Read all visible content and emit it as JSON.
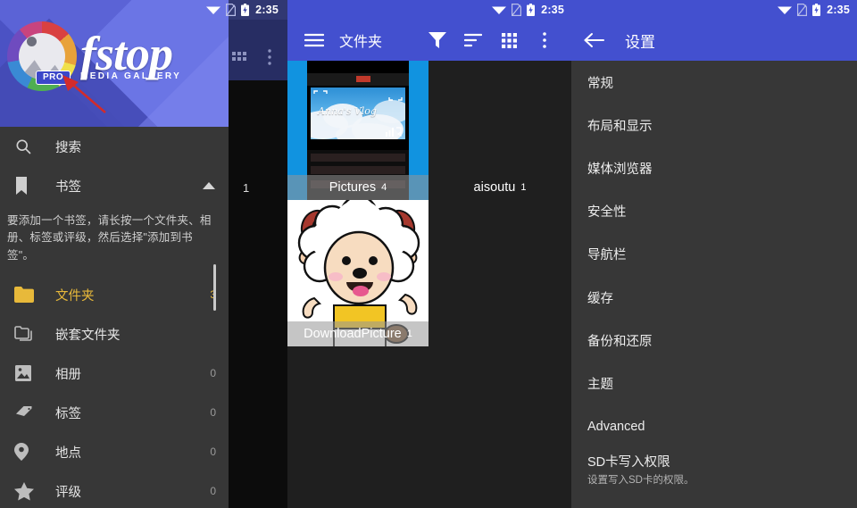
{
  "status_bar": {
    "time": "2:35",
    "icons": [
      "wifi-icon",
      "sim-card-icon",
      "battery-charging-icon"
    ]
  },
  "drawer": {
    "logo": {
      "word": "fstop",
      "subtitle": "MEDIA GALLERY",
      "badge": "PRO"
    },
    "search": {
      "label": "搜索",
      "icon": "search-icon"
    },
    "bookmarks": {
      "label": "书签",
      "icon": "bookmark-icon",
      "chevron": "chevron-up-icon",
      "note": "要添加一个书签，请长按一个文件夹、相册、标签或评级，然后选择\"添加到书签\"。"
    },
    "items": [
      {
        "label": "文件夹",
        "count": "3",
        "icon": "folder-icon",
        "active": true
      },
      {
        "label": "嵌套文件夹",
        "count": "",
        "icon": "nested-folder-icon",
        "active": false
      },
      {
        "label": "相册",
        "count": "0",
        "icon": "album-icon",
        "active": false
      },
      {
        "label": "标签",
        "count": "0",
        "icon": "tag-icon",
        "active": false
      },
      {
        "label": "地点",
        "count": "0",
        "icon": "location-pin-icon",
        "active": false
      },
      {
        "label": "评级",
        "count": "0",
        "icon": "star-icon",
        "active": false
      }
    ]
  },
  "background_panel": {
    "grid_icon": "grid-icon",
    "overflow_icon": "overflow-menu-icon",
    "partial_label": "1"
  },
  "folders": {
    "title": "文件夹",
    "nav_icon": "hamburger-menu-icon",
    "actions": [
      {
        "name": "filter-icon"
      },
      {
        "name": "sort-icon"
      },
      {
        "name": "grid-view-icon"
      },
      {
        "name": "overflow-menu-icon"
      }
    ],
    "thumbnails": [
      {
        "label": "Pictures",
        "count": "4",
        "art": "phone-screenshot-annas-vlog",
        "art_text": "Anna's Vlog"
      },
      {
        "label": "aisoutu",
        "count": "1",
        "art": "dark-empty"
      },
      {
        "label": "DownloadPicture",
        "count": "1",
        "art": "cartoon-sheep"
      }
    ]
  },
  "settings": {
    "title": "设置",
    "back_icon": "back-arrow-icon",
    "items": [
      {
        "title": "常规",
        "subtitle": ""
      },
      {
        "title": "布局和显示",
        "subtitle": ""
      },
      {
        "title": "媒体浏览器",
        "subtitle": ""
      },
      {
        "title": "安全性",
        "subtitle": ""
      },
      {
        "title": "导航栏",
        "subtitle": ""
      },
      {
        "title": "缓存",
        "subtitle": ""
      },
      {
        "title": "备份和还原",
        "subtitle": ""
      },
      {
        "title": "主题",
        "subtitle": ""
      },
      {
        "title": "Advanced",
        "subtitle": ""
      },
      {
        "title": "SD卡写入权限",
        "subtitle": "设置写入SD卡的权限。"
      }
    ]
  },
  "colors": {
    "accent_blue": "#4350cf",
    "panel_dark": "#373737",
    "browser_dark": "#1f1f1f",
    "active_amber": "#e8b93a"
  }
}
